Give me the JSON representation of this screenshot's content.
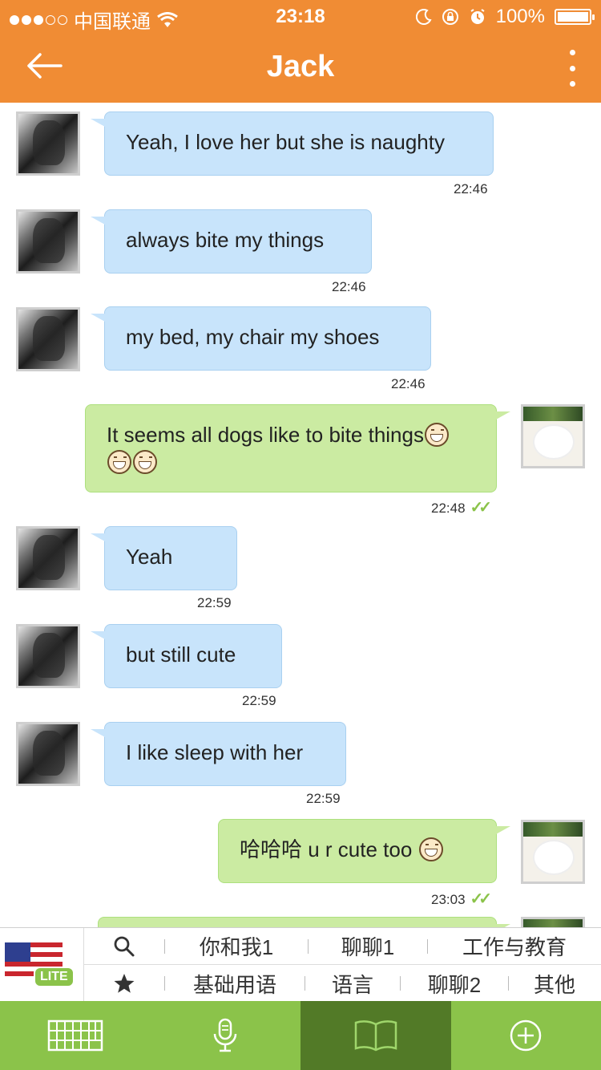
{
  "status_bar": {
    "carrier": "中国联通",
    "time": "23:18",
    "battery": "100%",
    "signal_dots": [
      true,
      true,
      true,
      false,
      false
    ],
    "icons": [
      "wifi-icon",
      "moon-icon",
      "rotation-lock-icon",
      "alarm-icon",
      "battery-icon"
    ]
  },
  "header": {
    "title": "Jack",
    "back_icon": "back-arrow-icon",
    "menu_icon": "more-vertical-icon",
    "color": "#f08c34"
  },
  "messages": [
    {
      "side": "in",
      "text": "Yeah, I love her but she is naughty",
      "time": "22:46"
    },
    {
      "side": "in",
      "text": "always bite my things",
      "time": "22:46"
    },
    {
      "side": "in",
      "text": "my bed, my chair my shoes",
      "time": "22:46"
    },
    {
      "side": "out",
      "text": "It seems all dogs like to bite things",
      "emoji_count": 3,
      "time": "22:48",
      "read": true
    },
    {
      "side": "in",
      "text": "Yeah",
      "time": "22:59"
    },
    {
      "side": "in",
      "text": "but still cute",
      "time": "22:59"
    },
    {
      "side": "in",
      "text": "I like sleep with her",
      "time": "22:59"
    },
    {
      "side": "out",
      "text": "哈哈哈 u r cute too ",
      "emoji_count": 1,
      "time": "23:03",
      "read": true
    }
  ],
  "phrase_panel": {
    "badge": "LITE",
    "flag_icon": "us-flag-icon",
    "row1": {
      "icon": "search-icon",
      "items": [
        "你和我1",
        "聊聊1",
        "工作与教育"
      ]
    },
    "row2": {
      "icon": "star-icon",
      "items": [
        "基础用语",
        "语言",
        "聊聊2",
        "其他"
      ]
    }
  },
  "toolbar": {
    "items": [
      "keyboard-icon",
      "microphone-icon",
      "book-icon",
      "add-circle-icon"
    ],
    "active_index": 2,
    "color": "#8bc34a",
    "active_color": "#527a27"
  },
  "colors": {
    "incoming_bubble": "#c8e4fb",
    "outgoing_bubble": "#cbeba2",
    "read_tick": "#8bc34a"
  }
}
